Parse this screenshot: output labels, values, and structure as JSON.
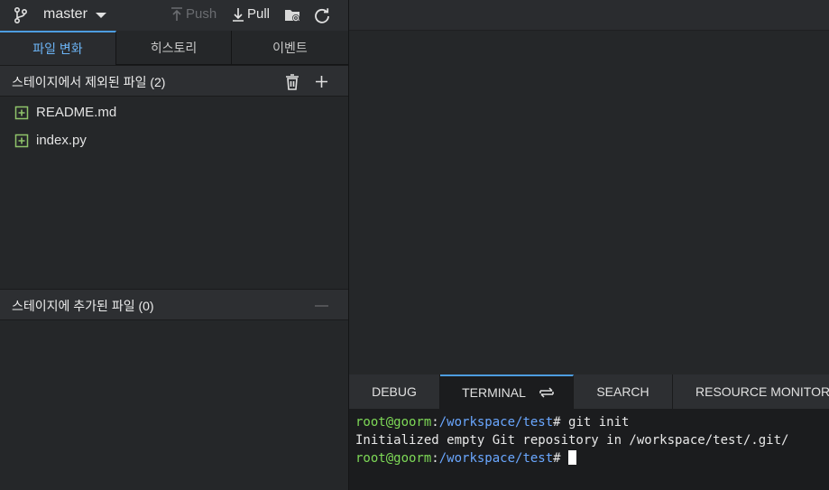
{
  "git": {
    "branch": "master",
    "push_label": "Push",
    "pull_label": "Pull",
    "tabs": [
      "파일 변화",
      "히스토리",
      "이벤트"
    ],
    "unstaged_title": "스테이지에서 제외된 파일 (2)",
    "unstaged_files": [
      "README.md",
      "index.py"
    ],
    "staged_title": "스테이지에 추가된 파일 (0)"
  },
  "bottom_panel": {
    "tabs": [
      "DEBUG",
      "TERMINAL",
      "SEARCH",
      "RESOURCE MONITOR"
    ],
    "terminal": {
      "user": "root@goorm",
      "sep": ":",
      "path": "/workspace/test",
      "prompt_char": "# ",
      "command1": "git init",
      "output1": "Initialized empty Git repository in /workspace/test/.git/"
    }
  },
  "colors": {
    "accent": "#4d9de0",
    "terminal_user": "#7ed957",
    "terminal_path": "#6aa7ff"
  }
}
